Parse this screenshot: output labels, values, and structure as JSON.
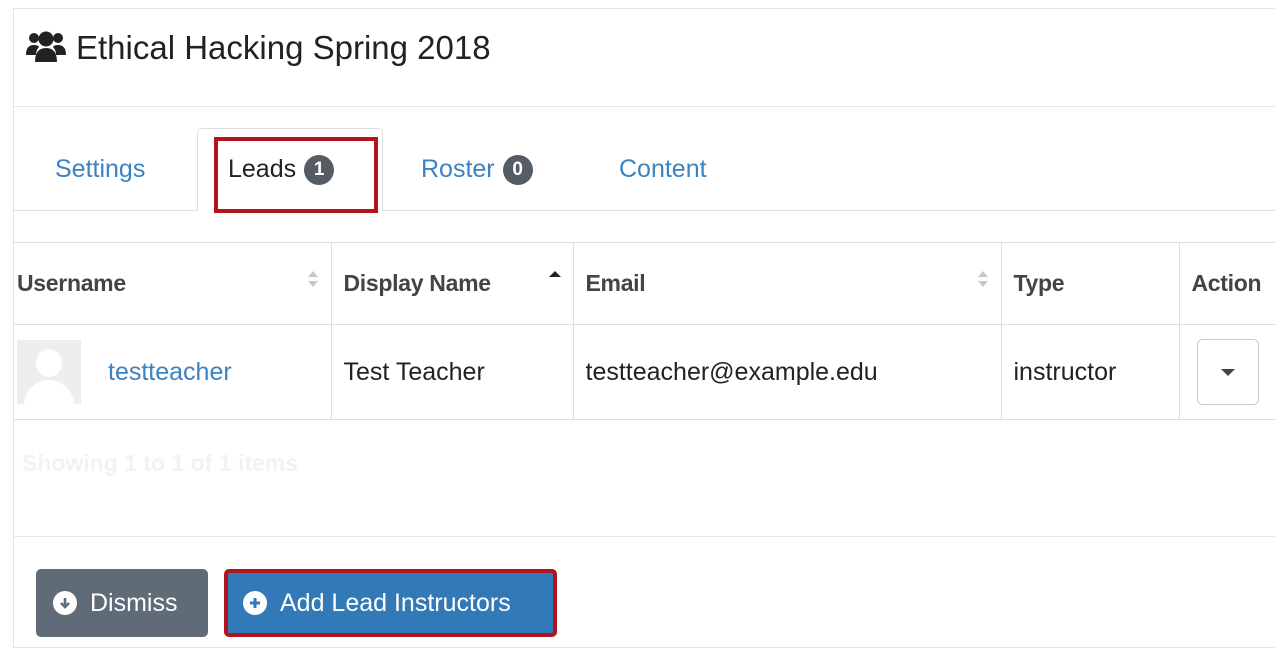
{
  "header": {
    "icon": "users-icon",
    "title": "Ethical Hacking Spring 2018"
  },
  "tabs": [
    {
      "label": "Settings"
    },
    {
      "label": "Leads",
      "badge": "1"
    },
    {
      "label": "Roster",
      "badge": "0"
    },
    {
      "label": "Content"
    }
  ],
  "table": {
    "columns": [
      {
        "label": "Username",
        "sort": "both"
      },
      {
        "label": "Display Name",
        "sort": "asc"
      },
      {
        "label": "Email",
        "sort": "both"
      },
      {
        "label": "Type"
      },
      {
        "label": "Action"
      }
    ],
    "rows": [
      {
        "username": "testteacher",
        "display_name": "Test Teacher",
        "email": "testteacher@example.edu",
        "type": "instructor"
      }
    ],
    "info": "Showing 1 to 1 of 1 items"
  },
  "footer": {
    "dismiss_label": "Dismiss",
    "add_label": "Add Lead Instructors"
  },
  "colors": {
    "link": "#3c82c0",
    "primary": "#3279b7",
    "secondary": "#5f6b76",
    "highlight": "#b0141f",
    "badge": "#555c63"
  }
}
